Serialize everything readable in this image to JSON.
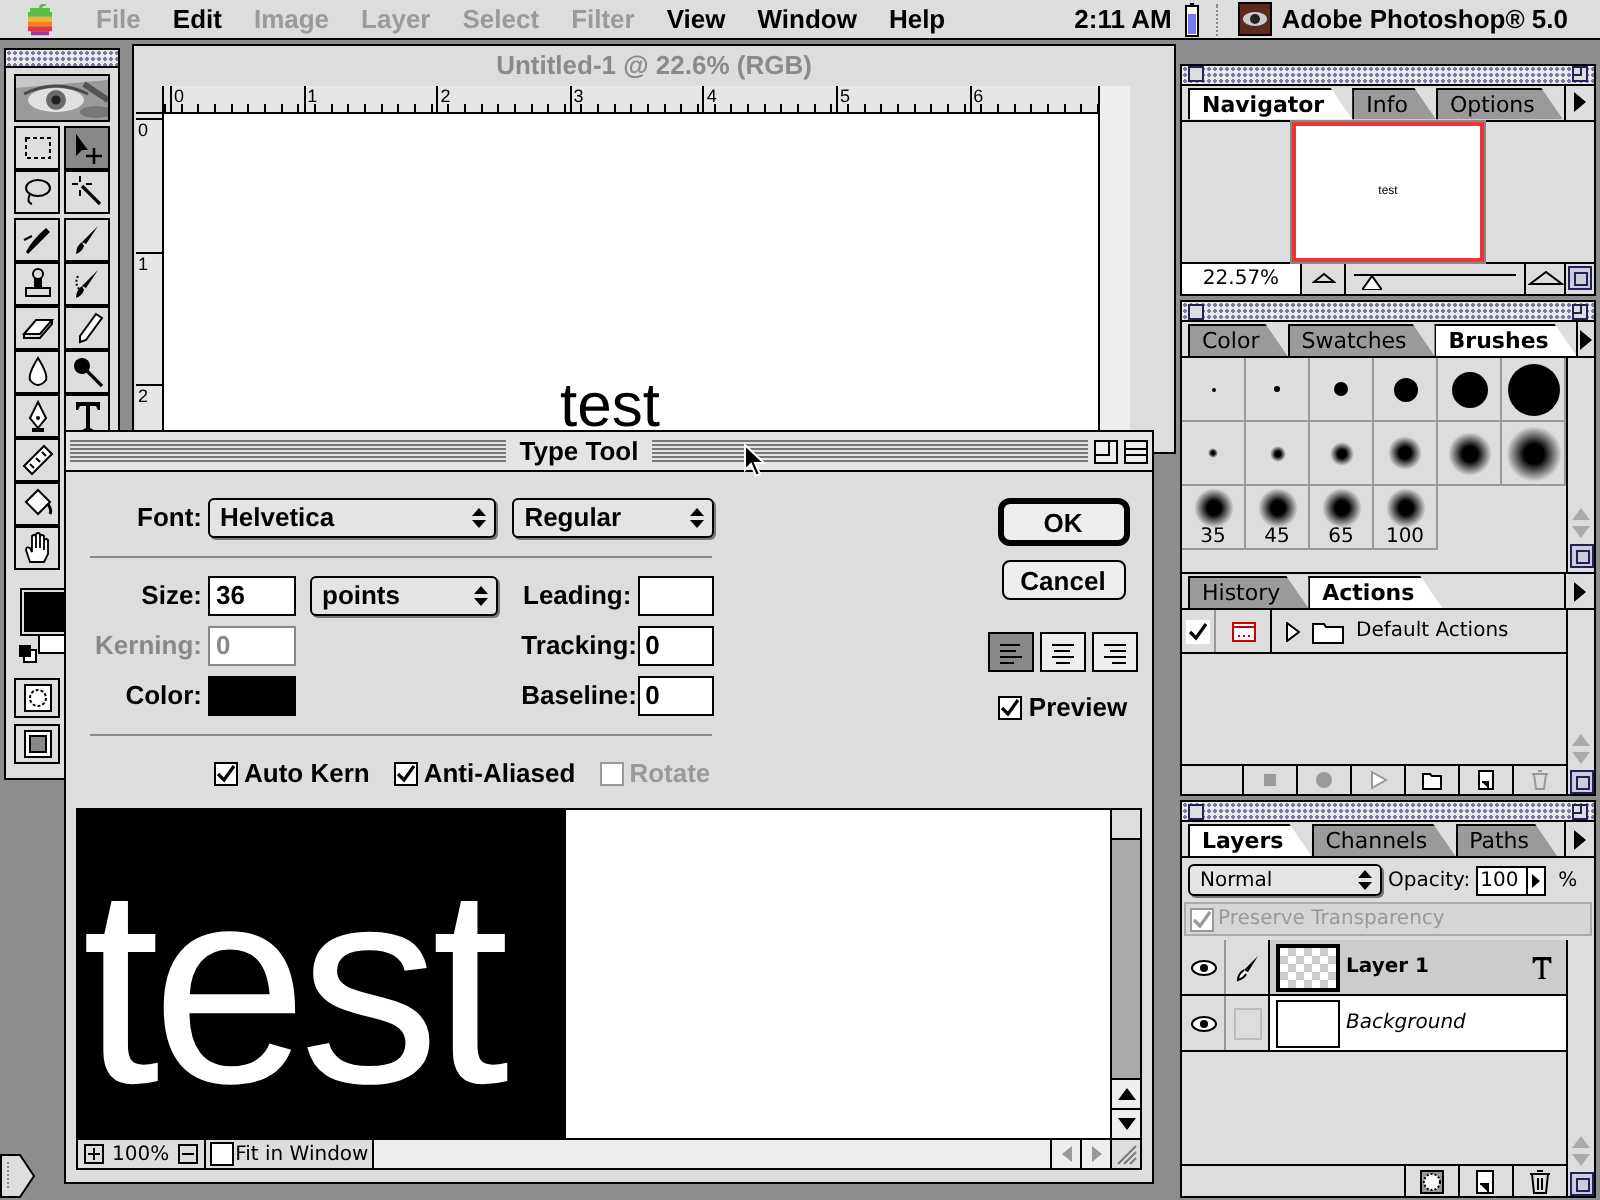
{
  "menu_bar": {
    "items": [
      {
        "label": "File",
        "disabled": true
      },
      {
        "label": "Edit",
        "disabled": false
      },
      {
        "label": "Image",
        "disabled": true
      },
      {
        "label": "Layer",
        "disabled": true
      },
      {
        "label": "Select",
        "disabled": true
      },
      {
        "label": "Filter",
        "disabled": true
      },
      {
        "label": "View",
        "disabled": false
      },
      {
        "label": "Window",
        "disabled": false
      },
      {
        "label": "Help",
        "disabled": false
      }
    ],
    "clock": "2:11 AM",
    "app_name": "Adobe Photoshop® 5.0"
  },
  "toolbox": {
    "tool_rows": [
      [
        {
          "kind": "marquee",
          "selected": false
        },
        {
          "kind": "move",
          "selected": true
        }
      ],
      [
        {
          "kind": "lasso",
          "selected": false
        },
        {
          "kind": "wand",
          "selected": false
        }
      ],
      [
        {
          "kind": "airbrush",
          "selected": false
        },
        {
          "kind": "brush",
          "selected": false
        }
      ],
      [
        {
          "kind": "stamp",
          "selected": false
        },
        {
          "kind": "history-brush",
          "selected": false
        }
      ],
      [
        {
          "kind": "eraser",
          "selected": false
        },
        {
          "kind": "pencil",
          "selected": false
        }
      ],
      [
        {
          "kind": "blur",
          "selected": false
        },
        {
          "kind": "burn",
          "selected": false
        }
      ],
      [
        {
          "kind": "pen",
          "selected": false
        },
        {
          "kind": "type",
          "selected": false
        }
      ],
      [
        {
          "kind": "measure",
          "selected": false
        }
      ],
      [
        {
          "kind": "bucket",
          "selected": false
        }
      ],
      [
        {
          "kind": "hand",
          "selected": false
        }
      ]
    ]
  },
  "document": {
    "title": "Untitled-1 @ 22.6% (RGB)",
    "ruler_marks": [
      "0",
      "1",
      "2",
      "3",
      "4",
      "5",
      "6"
    ],
    "vertical_ruler_marks": [
      "0",
      "1",
      "2"
    ],
    "canvas_text": "test"
  },
  "type_tool": {
    "title": "Type Tool",
    "font_label": "Font:",
    "font": "Helvetica",
    "style": "Regular",
    "size": {
      "label": "Size:",
      "value": "36",
      "units": "points"
    },
    "kerning": {
      "label": "Kerning:",
      "value": "0",
      "disabled": true
    },
    "color": {
      "label": "Color:",
      "color": "#000000"
    },
    "right_fields": [
      {
        "label": "Leading:"
      },
      {
        "label": "Tracking:",
        "value": "0"
      },
      {
        "label": "Baseline:",
        "value": "0"
      }
    ],
    "options": [
      {
        "label": "Auto Kern",
        "checked": true,
        "disabled": false
      },
      {
        "label": "Anti-Aliased",
        "checked": true,
        "disabled": false
      },
      {
        "label": "Rotate",
        "checked": false,
        "disabled": true
      }
    ],
    "buttons": [
      {
        "label": "OK",
        "default": true
      },
      {
        "label": "Cancel",
        "default": false
      }
    ],
    "alignment": [
      {
        "kind": "left",
        "selected": true
      },
      {
        "kind": "center",
        "selected": false
      },
      {
        "kind": "right",
        "selected": false
      }
    ],
    "preview": {
      "label": "Preview",
      "checked": true
    },
    "preview_pane": {
      "text": "test",
      "zoom": "100%",
      "fit_in_window": {
        "label": "Fit in Window",
        "checked": false
      }
    }
  },
  "navigator": {
    "tabs": [
      {
        "label": "Navigator",
        "selected": true
      },
      {
        "label": "Info",
        "selected": false
      },
      {
        "label": "Options",
        "selected": false
      }
    ],
    "thumbnail_text": "test",
    "zoom": "22.57%",
    "zoom_slider": {
      "level": 0.05
    }
  },
  "brushes_palette": {
    "tabs": [
      {
        "label": "Color",
        "selected": false
      },
      {
        "label": "Swatches",
        "selected": false
      },
      {
        "label": "Brushes",
        "selected": true
      }
    ],
    "brushes": [
      {
        "kind": "hard"
      },
      {
        "kind": "hard"
      },
      {
        "kind": "hard"
      },
      {
        "kind": "hard"
      },
      {
        "kind": "hard"
      },
      {
        "kind": "hard"
      },
      {
        "kind": "soft"
      },
      {
        "kind": "soft"
      },
      {
        "kind": "soft"
      },
      {
        "kind": "soft"
      },
      {
        "kind": "soft"
      },
      {
        "kind": "soft"
      },
      {
        "kind": "soft",
        "label": "35"
      },
      {
        "kind": "soft",
        "label": "45"
      },
      {
        "kind": "soft",
        "label": "65"
      },
      {
        "kind": "soft",
        "label": "100"
      }
    ]
  },
  "actions_palette": {
    "tabs": [
      {
        "label": "History",
        "selected": false
      },
      {
        "label": "Actions",
        "selected": true
      }
    ],
    "actions": [
      {
        "name": "Default Actions",
        "checked": true,
        "expanded": false
      }
    ]
  },
  "layers_palette": {
    "tabs": [
      {
        "label": "Layers",
        "selected": true
      },
      {
        "label": "Channels",
        "selected": false
      },
      {
        "label": "Paths",
        "selected": false
      }
    ],
    "blend_mode": "Normal",
    "opacity_label": "Opacity:",
    "opacity": "100",
    "percent": "%",
    "preserve_transparency": {
      "label": "Preserve Transparency",
      "checked": true,
      "disabled": true
    },
    "layers": [
      {
        "name": "Layer 1",
        "kind": "text",
        "selected": true,
        "visible": true
      },
      {
        "name": "Background",
        "kind": "background",
        "selected": false,
        "visible": true
      }
    ]
  }
}
